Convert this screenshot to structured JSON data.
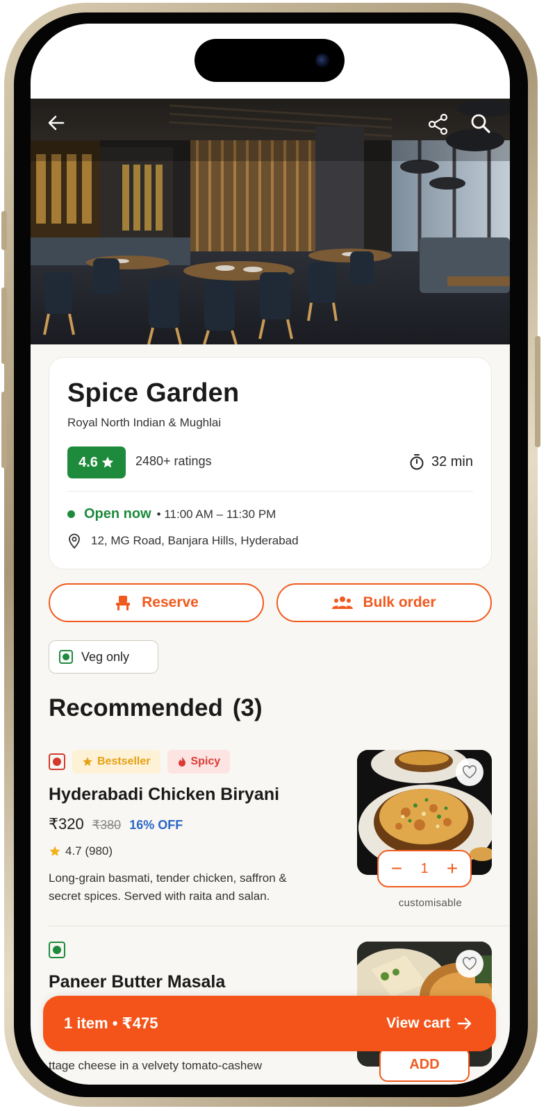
{
  "colors": {
    "accent": "#f05a1e",
    "rating_green": "#1d8a3c",
    "discount_blue": "#2a66c8",
    "cart_bar": "#f4541a"
  },
  "hero": {
    "back_icon": "arrow-left-icon",
    "share_icon": "share-icon",
    "search_icon": "search-icon"
  },
  "restaurant": {
    "name": "Spice Garden",
    "cuisine": "Royal North Indian & Mughlai",
    "rating": "4.6",
    "ratings_count": "2480+ ratings",
    "eta": "32 min",
    "status": "Open now",
    "hours": "• 11:00 AM – 11:30 PM",
    "address": "12, MG Road, Banjara Hills, Hyderabad"
  },
  "actions": {
    "reserve_label": "Reserve",
    "bulk_label": "Bulk order"
  },
  "filters": {
    "veg_only_label": "Veg only",
    "veg_only_selected": false
  },
  "section": {
    "title": "Recommended",
    "count": "(3)"
  },
  "menu_items": [
    {
      "type": "non-veg",
      "tags": [
        "Bestseller",
        "Spicy"
      ],
      "name": "Hyderabadi Chicken Biryani",
      "price": "₹320",
      "mrp": "₹380",
      "discount": "16% OFF",
      "rating": "4.7 (980)",
      "description_line1": "Long-grain basmati, tender chicken, saffron &",
      "description_line2": "secret spices. Served with raita and salan.",
      "quantity": "1",
      "minus_label": "−",
      "plus_label": "+",
      "note": "customisable"
    },
    {
      "type": "veg",
      "name": "Paneer Butter Masala",
      "description_line1": "ttage cheese in a velvety tomato-cashew",
      "add_label": "ADD"
    }
  ],
  "cart": {
    "summary": "1 item • ₹475",
    "cta": "View cart"
  }
}
